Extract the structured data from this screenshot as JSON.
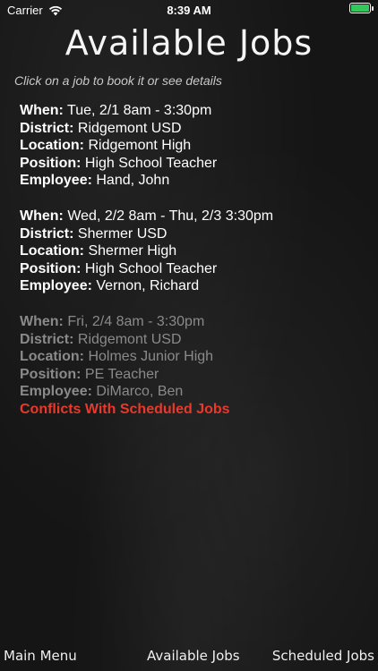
{
  "status_bar": {
    "carrier": "Carrier",
    "time": "8:39 AM",
    "battery_color": "#34c759"
  },
  "header": {
    "title": "Available Jobs",
    "subtitle": "Click on a job to book it or see details"
  },
  "labels": {
    "when": "When:",
    "district": "District:",
    "location": "Location:",
    "position": "Position:",
    "employee": "Employee:"
  },
  "jobs": [
    {
      "when": "Tue, 2/1 8am - 3:30pm",
      "district": "Ridgemont USD",
      "location": "Ridgemont High",
      "position": "High School Teacher",
      "employee": "Hand, John"
    },
    {
      "when": "Wed, 2/2 8am - Thu, 2/3 3:30pm",
      "district": "Shermer USD",
      "location": "Shermer High",
      "position": "High School Teacher",
      "employee": "Vernon, Richard"
    },
    {
      "when": "Fri, 2/4 8am - 3:30pm",
      "district": "Ridgemont USD",
      "location": "Holmes Junior High",
      "position": "PE Teacher",
      "employee": "DiMarco, Ben",
      "conflict": "Conflicts With Scheduled Jobs"
    }
  ],
  "tabs": {
    "main_menu": "Main Menu",
    "available_jobs": "Available Jobs",
    "scheduled_jobs": "Scheduled Jobs"
  },
  "colors": {
    "conflict": "#e8392a",
    "disabled_text": "#8a8a8a"
  }
}
